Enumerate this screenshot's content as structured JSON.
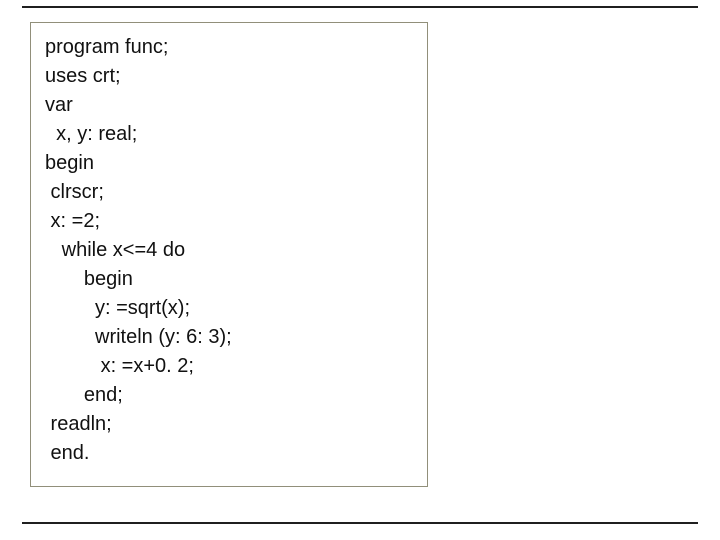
{
  "code": {
    "lines": [
      "program func;",
      "uses crt;",
      "var",
      "  x, y: real;",
      "begin",
      " clrscr;",
      " x: =2;",
      "   while x<=4 do",
      "       begin",
      "         y: =sqrt(x);",
      "         writeln (y: 6: 3);",
      "          x: =x+0. 2;",
      "       end;",
      " readln;",
      " end."
    ]
  }
}
